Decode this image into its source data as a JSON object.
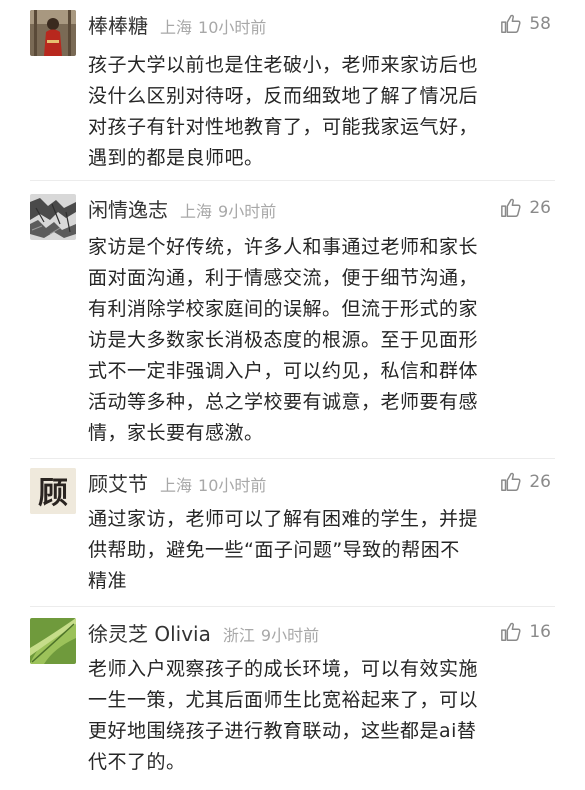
{
  "comments": [
    {
      "username": "棒棒糖",
      "location": "上海",
      "time": "10小时前",
      "likes": "58",
      "lines": [
        "孩子大学以前也是住老破小，老师来家访后也",
        "没什么区别对待呀，反而细致地了解了情况后",
        "对孩子有针对性地教育了，可能我家运气好，",
        "遇到的都是良师吧。"
      ]
    },
    {
      "username": "闲情逸志",
      "location": "上海",
      "time": "9小时前",
      "likes": "26",
      "lines": [
        "家访是个好传统，许多人和事通过老师和家长",
        "面对面沟通，利于情感交流，便于细节沟通，",
        "有利消除学校家庭间的误解。但流于形式的家",
        "访是大多数家长消极态度的根源。至于见面形",
        "式不一定非强调入户，可以约见，私信和群体",
        "活动等多种，总之学校要有诚意，老师要有感",
        "情，家长要有感激。"
      ]
    },
    {
      "username": "顾艾节",
      "location": "上海",
      "time": "10小时前",
      "likes": "26",
      "avatar_text": "顾",
      "lines": [
        "通过家访，老师可以了解有困难的学生，并提",
        "供帮助，避免一些“面子问题”导致的帮困不",
        "精准"
      ]
    },
    {
      "username": "徐灵芝 Olivia",
      "location": "浙江",
      "time": "9小时前",
      "likes": "16",
      "lines": [
        "老师入户观察孩子的成长环境，可以有效实施",
        "一生一策，尤其后面师生比宽裕起来了，可以",
        "更好地围绕孩子进行教育联动，这些都是ai替",
        "代不了的。"
      ]
    }
  ],
  "icons": {
    "like": "thumbs-up-icon"
  },
  "colors": {
    "username": "#333333",
    "meta": "#a8a8a8",
    "like": "#8a8a8a",
    "text": "#262626"
  }
}
